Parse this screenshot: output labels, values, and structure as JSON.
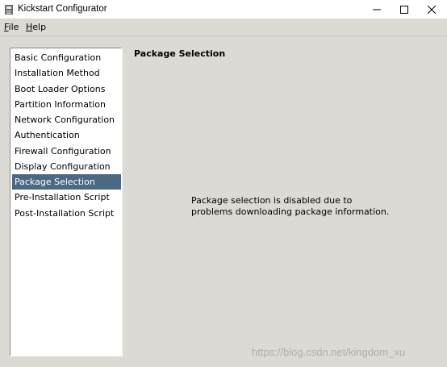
{
  "window": {
    "title": "Kickstart Configurator"
  },
  "menu": {
    "file": {
      "mnemonic": "F",
      "rest": "ile"
    },
    "help": {
      "mnemonic": "H",
      "rest": "elp"
    }
  },
  "sidebar": {
    "selected_index": 8,
    "items": [
      {
        "label": "Basic Configuration"
      },
      {
        "label": "Installation Method"
      },
      {
        "label": "Boot Loader Options"
      },
      {
        "label": "Partition Information"
      },
      {
        "label": "Network Configuration"
      },
      {
        "label": "Authentication"
      },
      {
        "label": "Firewall Configuration"
      },
      {
        "label": "Display Configuration"
      },
      {
        "label": "Package Selection"
      },
      {
        "label": "Pre-Installation Script"
      },
      {
        "label": "Post-Installation Script"
      }
    ]
  },
  "content": {
    "title": "Package Selection",
    "message_line1": "Package selection is disabled due to",
    "message_line2": "problems downloading package information."
  },
  "watermark": "https://blog.csdn.net/kingdom_xu",
  "colors": {
    "selection": "#4b6983",
    "window_bg": "#dcdad5"
  }
}
